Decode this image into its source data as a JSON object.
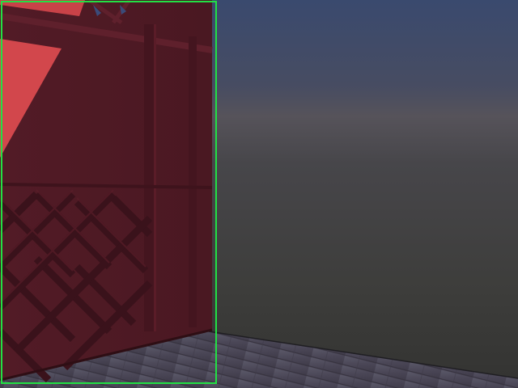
{
  "scene": {
    "description_free": true,
    "colors": {
      "sky_top": "#3b4766",
      "sky_mid": "#4a4b55",
      "sky_bottom": "#3a3a38",
      "floor": "#4a4858",
      "barn_wall": "#4c1a24",
      "barn_beam": "#5e1f2b",
      "barn_beam_dark": "#3d131c",
      "roof_accent": "#d44a4e",
      "selection": "#22e044"
    }
  }
}
